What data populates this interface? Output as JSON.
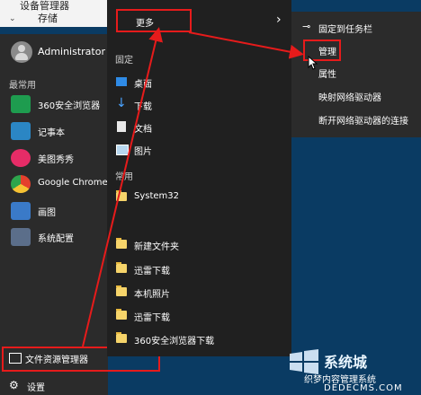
{
  "top": {
    "row1": "设备管理器",
    "row2": "存储"
  },
  "start": {
    "user": "Administrator",
    "section_frequent": "最常用",
    "apps": [
      {
        "label": "360安全浏览器",
        "color": "#1e9c4f"
      },
      {
        "label": "记事本",
        "color": "#2b86c4"
      },
      {
        "label": "美图秀秀",
        "color": "#e62c67"
      },
      {
        "label": "Google Chrome",
        "color": "#e4402d"
      },
      {
        "label": "画图",
        "color": "#3a7ac8"
      },
      {
        "label": "系统配置",
        "color": "#5b6e8a"
      }
    ],
    "file_explorer": "文件资源管理器",
    "settings": "设置"
  },
  "jumplist": {
    "more": "更多",
    "pinned_header": "固定",
    "pinned": [
      "桌面",
      "下载",
      "文档",
      "图片"
    ],
    "frequent_header": "常用",
    "frequent": [
      "System32",
      "新建文件夹",
      "迅雷下载",
      "本机照片",
      "迅雷下载",
      "360安全浏览器下载"
    ]
  },
  "context": {
    "items": [
      "固定到任务栏",
      "管理",
      "属性",
      "映射网络驱动器",
      "断开网络驱动器的连接"
    ]
  },
  "watermark": {
    "brand": "系统城",
    "site_name": "织梦内容管理系统",
    "site_url": "DEDECMS.COM"
  },
  "colors": {
    "highlight": "#e61b1b",
    "start_bg": "#2b2b2b",
    "jump_bg": "#202020",
    "desktop": "#0a3b63"
  }
}
